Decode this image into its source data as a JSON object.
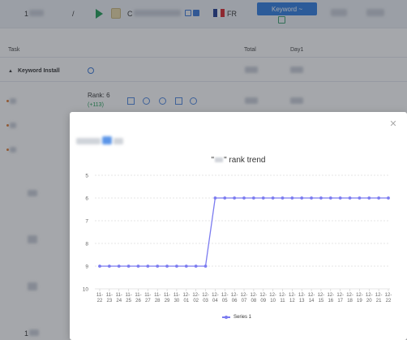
{
  "topbar": {
    "item_1": "1",
    "item_separator": "/",
    "ca_prefix": "C",
    "country_code": "FR",
    "keyword_button": "Keyword ~"
  },
  "table": {
    "headers": {
      "task": "Task",
      "total": "Total",
      "day1": "Day1"
    },
    "group_title": "Keyword Install",
    "row": {
      "rank": "Rank: 6",
      "delta": "(+113)"
    },
    "footer_number": "1"
  },
  "modal": {
    "chart_title_prefix": "\"",
    "chart_title_suffix": "\" rank trend"
  },
  "colors": {
    "series": "#7b7bf0",
    "accent_button": "#2f7de1",
    "positive": "#1f9d55"
  },
  "icons": [
    "play-icon",
    "bag-icon",
    "copy-icon",
    "flag-fr-icon",
    "clock-icon",
    "mail-icon",
    "refresh-icon",
    "target-icon",
    "close-icon"
  ],
  "chart_data": {
    "type": "line",
    "title": "\"\" rank trend",
    "categories": [
      "11-22",
      "11-23",
      "11-24",
      "11-25",
      "11-26",
      "11-27",
      "11-28",
      "11-29",
      "11-30",
      "12-01",
      "12-02",
      "12-03",
      "12-04",
      "12-05",
      "12-06",
      "12-07",
      "12-08",
      "12-09",
      "12-10",
      "12-11",
      "12-12",
      "12-13",
      "12-14",
      "12-15",
      "12-16",
      "12-17",
      "12-18",
      "12-19",
      "12-20",
      "12-21",
      "12-22"
    ],
    "series": [
      {
        "name": "Series 1",
        "values": [
          9,
          9,
          9,
          9,
          9,
          9,
          9,
          9,
          9,
          9,
          9,
          9,
          6,
          6,
          6,
          6,
          6,
          6,
          6,
          6,
          6,
          6,
          6,
          6,
          6,
          6,
          6,
          6,
          6,
          6,
          6
        ]
      }
    ],
    "y_ticks": [
      "5",
      "6",
      "7",
      "8",
      "9",
      "10"
    ],
    "ylim": [
      5,
      10
    ],
    "y_inverted": true,
    "grid": true,
    "legend": "bottom"
  }
}
